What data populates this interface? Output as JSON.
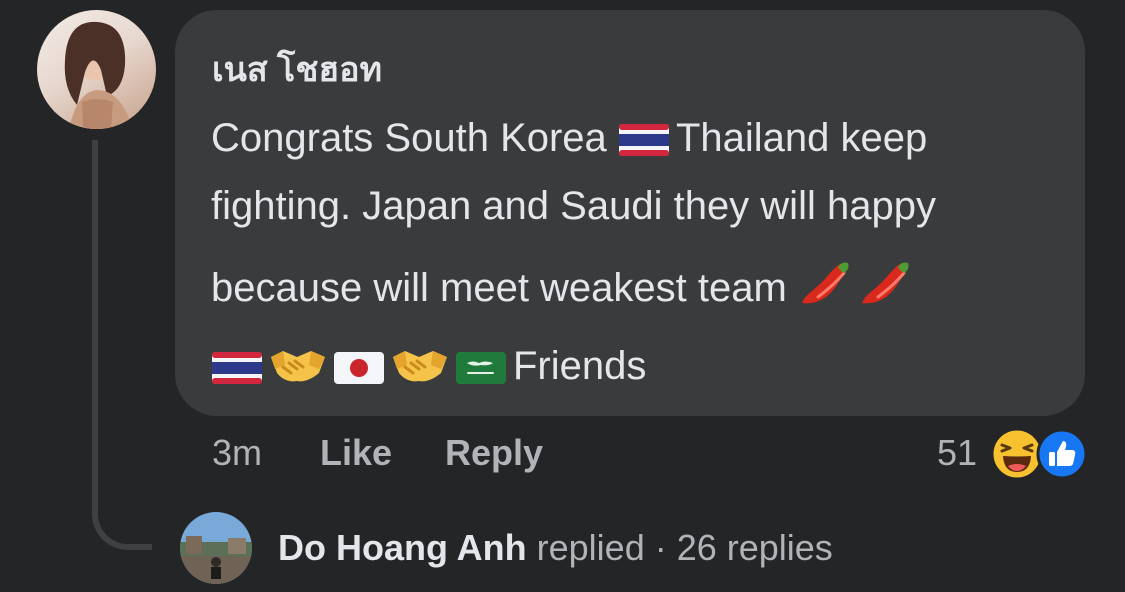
{
  "comment": {
    "author": "เนส โชฮอท",
    "line1_text": "Congrats South Korea",
    "line1_flag_icon": "thailand-flag-icon",
    "line1_cont": "Thailand keep",
    "line2": "fighting. Japan and Saudi they will happy",
    "line3": "because will meet weakest team",
    "line3_icons": [
      "chili-pepper-icon",
      "chili-pepper-icon"
    ],
    "line4_icons": [
      "thailand-flag-icon",
      "handshake-icon",
      "japan-flag-icon",
      "handshake-icon",
      "saudi-flag-icon"
    ],
    "line4_text": "Friends"
  },
  "actions": {
    "time": "3m",
    "like": "Like",
    "reply": "Reply"
  },
  "reactions": {
    "count": "51",
    "icons": [
      "haha-reaction-icon",
      "like-reaction-icon"
    ]
  },
  "replies": {
    "name": "Do Hoang Anh",
    "suffix": "replied · 26 replies"
  },
  "colors": {
    "background": "#242526",
    "bubble": "#3a3b3c",
    "primary_text": "#e4e6eb",
    "secondary_text": "#b0b3b8",
    "like_blue": "#1877f2",
    "haha_yellow": "#f7c12f"
  }
}
